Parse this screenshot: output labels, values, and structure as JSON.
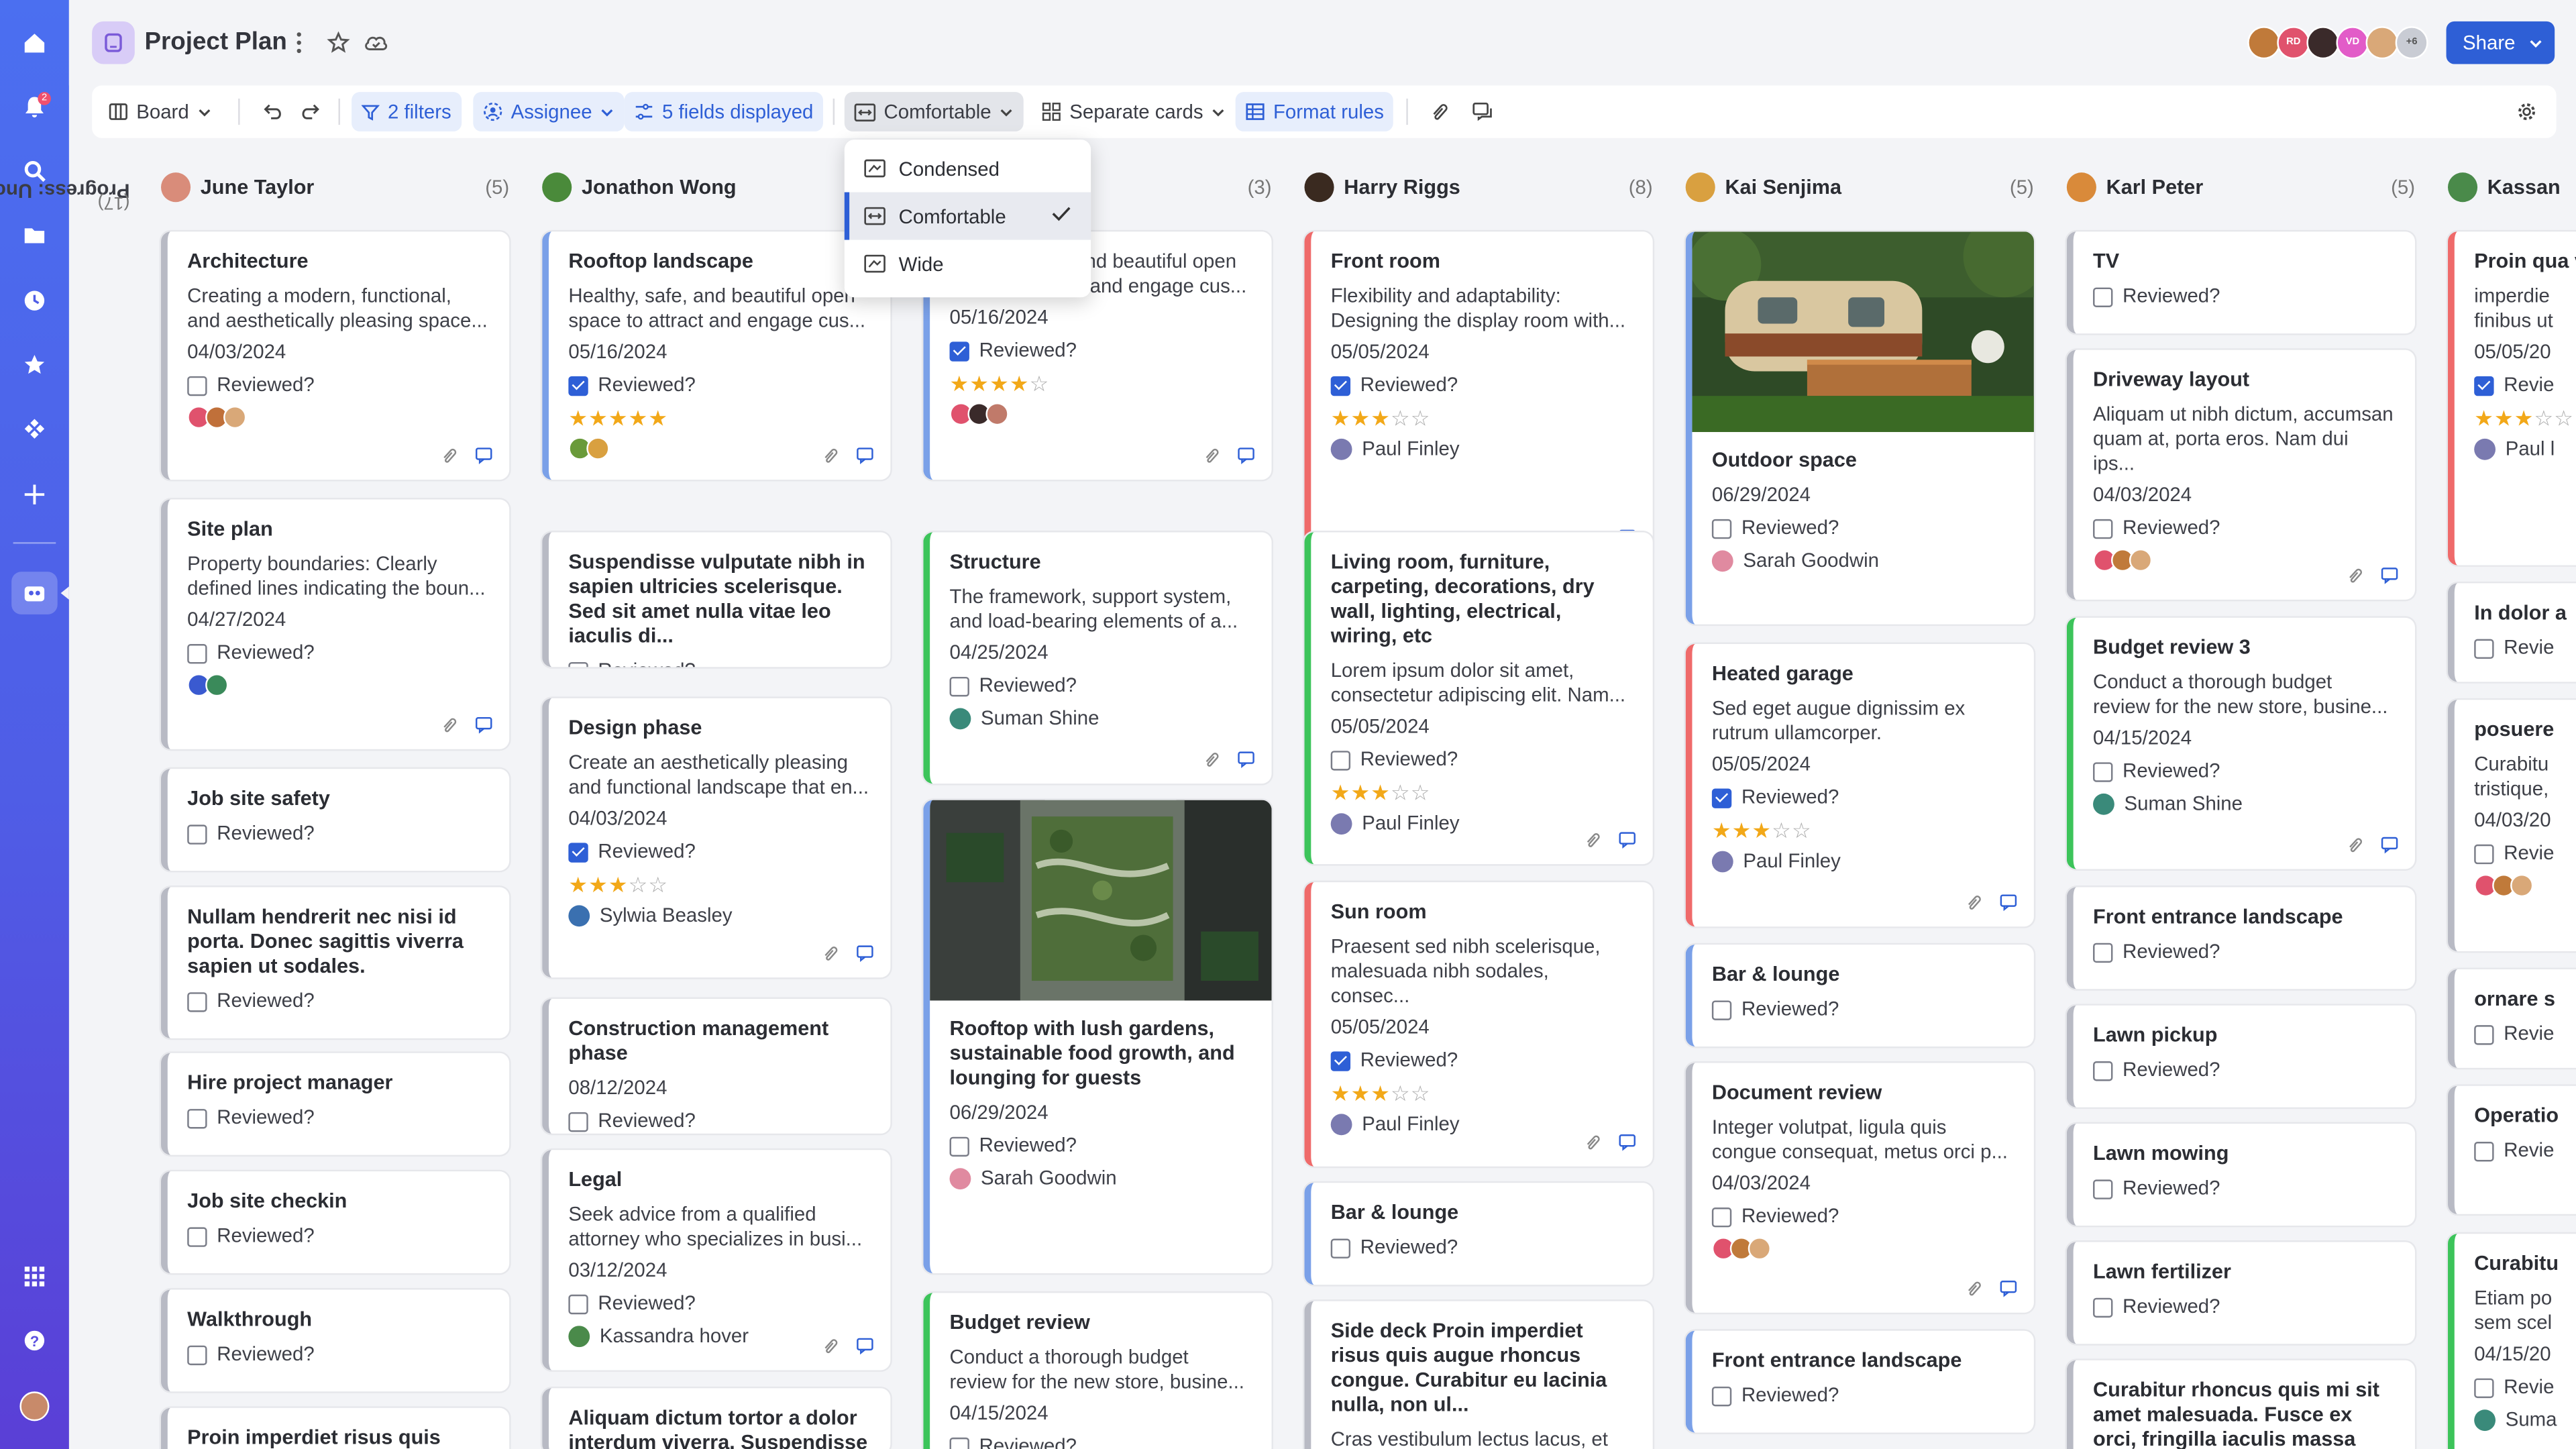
{
  "app": {
    "title": "Project Plan",
    "notification_count": "2",
    "share_label": "Share",
    "collaborators": [
      {
        "initials": "",
        "color": "#c07a3a"
      },
      {
        "initials": "RD",
        "color": "#e0526d"
      },
      {
        "initials": "",
        "color": "#3a2a2a"
      },
      {
        "initials": "VD",
        "color": "#e25cc8"
      },
      {
        "initials": "",
        "color": "#d9a878"
      },
      {
        "initials": "+6",
        "color": "#c9ccd4"
      }
    ]
  },
  "toolbar": {
    "view": "Board",
    "filters": "2 filters",
    "group_by": "Assignee",
    "fields": "5 fields displayed",
    "density": "Comfortable",
    "card_style": "Separate cards",
    "format_rules": "Format rules"
  },
  "density_menu": {
    "options": [
      "Condensed",
      "Comfortable",
      "Wide"
    ],
    "selected": "Comfortable"
  },
  "group": {
    "label": "Progress: Uncategorized",
    "count": "(17)"
  },
  "columns": [
    {
      "name": "June Taylor",
      "count": "(5)",
      "avatar": "#d98c7a",
      "cards": [
        {
          "title": "Architecture",
          "desc": "Creating a modern, functional,\nand aesthetically pleasing space...",
          "date": "04/03/2024",
          "reviewed_label": "Reviewed?",
          "reviewed": false,
          "avatars": [
            "#e0526d",
            "#c0703a",
            "#d9a878"
          ],
          "accent": "#b8bac4"
        },
        {
          "title": "Site plan",
          "desc": "Property boundaries: Clearly\ndefined lines indicating the boun...",
          "date": "04/27/2024",
          "reviewed_label": "Reviewed?",
          "reviewed": false,
          "avatars": [
            "#3a5ad0",
            "#3a8a5a"
          ],
          "accent": "#b8bac4"
        },
        {
          "title": "Job site safety",
          "reviewed_label": "Reviewed?",
          "reviewed": false,
          "accent": "#b8bac4"
        },
        {
          "title": "Nullam hendrerit nec nisi id porta. Donec sagittis viverra sapien ut sodales.",
          "reviewed_label": "Reviewed?",
          "reviewed": false,
          "accent": "#b8bac4"
        },
        {
          "title": "Hire project manager",
          "reviewed_label": "Reviewed?",
          "reviewed": false,
          "accent": "#b8bac4"
        },
        {
          "title": "Job site checkin",
          "reviewed_label": "Reviewed?",
          "reviewed": false,
          "accent": "#b8bac4"
        },
        {
          "title": "Walkthrough",
          "reviewed_label": "Reviewed?",
          "reviewed": false,
          "accent": "#b8bac4"
        },
        {
          "title": "Proin imperdiet risus quis augue",
          "accent": "#b8bac4"
        }
      ]
    },
    {
      "name": "Jonathon Wong",
      "count": "",
      "avatar": "#4a8a3a",
      "cards": [
        {
          "title": "Rooftop landscape",
          "desc": "Healthy, safe, and beautiful open\nspace to attract and engage cus...",
          "date": "05/16/2024",
          "reviewed_label": "Reviewed?",
          "reviewed": true,
          "stars": 5,
          "avatars": [
            "#6a9a3a",
            "#d9a040"
          ],
          "accent": "#7aa0e8"
        },
        {
          "title": "Suspendisse vulputate nibh in sapien ultricies scelerisque. Sed sit amet nulla vitae leo iaculis di...",
          "reviewed_label": "Reviewed?",
          "reviewed": false,
          "accent": "#b8bac4"
        },
        {
          "title": "Design phase",
          "desc": "Create an aesthetically pleasing\nand functional landscape that en...",
          "date": "04/03/2024",
          "reviewed_label": "Reviewed?",
          "reviewed": true,
          "stars": 3,
          "person": "Sylwia Beasley",
          "person_color": "#3a70b0",
          "accent": "#b8bac4"
        },
        {
          "title": "Construction management phase",
          "date": "08/12/2024",
          "reviewed_label": "Reviewed?",
          "reviewed": false,
          "accent": "#b8bac4"
        },
        {
          "title": "Legal",
          "desc": "Seek advice from a qualified\nattorney who specializes in busi...",
          "date": "03/12/2024",
          "reviewed_label": "Reviewed?",
          "reviewed": false,
          "person": "Kassandra hover",
          "person_color": "#4a8a4a",
          "accent": "#b8bac4"
        },
        {
          "title": "Aliquam dictum tortor a dolor interdum viverra. Suspendisse et",
          "accent": "#b8bac4"
        }
      ]
    },
    {
      "name": "",
      "count": "(3)",
      "avatar": "",
      "cards": [
        {
          "title": "",
          "desc": "Healthy, safe, and beautiful open\nspace to attract and engage cus...",
          "date": "05/16/2024",
          "reviewed_label": "Reviewed?",
          "reviewed": true,
          "stars": 4,
          "avatars": [
            "#e0526d",
            "#3a2a2a",
            "#c07a6a"
          ],
          "accent": "#7aa0e8"
        },
        {
          "title": "Structure",
          "desc": "The framework, support system,\nand load-bearing elements of a...",
          "date": "04/25/2024",
          "reviewed_label": "Reviewed?",
          "reviewed": false,
          "person": "Suman Shine",
          "person_color": "#3a8a7a",
          "accent": "#3cc45a"
        },
        {
          "title": "Rooftop with lush gardens, sustainable food growth, and lounging for guests",
          "date": "06/29/2024",
          "reviewed_label": "Reviewed?",
          "reviewed": false,
          "person": "Sarah Goodwin",
          "person_color": "#e08aa0",
          "photo": "rooftop",
          "accent": "#7aa0e8"
        },
        {
          "title": "Budget review",
          "desc": "Conduct a thorough budget\nreview for the new store, busine...",
          "date": "04/15/2024",
          "reviewed_label": "Reviewed?",
          "accent": "#3cc45a"
        }
      ]
    },
    {
      "name": "Harry Riggs",
      "count": "(8)",
      "avatar": "#3a2a20",
      "cards": [
        {
          "title": "Front room",
          "desc": "Flexibility and adaptability:\nDesigning the display room with...",
          "date": "05/05/2024",
          "reviewed_label": "Reviewed?",
          "reviewed": true,
          "stars": 3,
          "person": "Paul Finley",
          "person_color": "#7a7ab0",
          "accent": "#ef6a6a"
        },
        {
          "title": "Living room, furniture, carpeting, decorations, dry wall, lighting, electrical, wiring, etc",
          "desc": "Lorem ipsum dolor sit amet,\nconsectetur adipiscing elit. Nam...",
          "date": "05/05/2024",
          "reviewed_label": "Reviewed?",
          "reviewed": false,
          "stars": 3,
          "person": "Paul Finley",
          "person_color": "#7a7ab0",
          "accent": "#3cc45a"
        },
        {
          "title": "Sun room",
          "desc": "Praesent sed nibh scelerisque,\nmalesuada nibh sodales, consec...",
          "date": "05/05/2024",
          "reviewed_label": "Reviewed?",
          "reviewed": true,
          "stars": 3,
          "person": "Paul Finley",
          "person_color": "#7a7ab0",
          "accent": "#ef6a6a"
        },
        {
          "title": "Bar & lounge",
          "reviewed_label": "Reviewed?",
          "reviewed": false,
          "accent": "#7aa0e8"
        },
        {
          "title": "Side deck Proin imperdiet risus quis augue rhoncus congue. Curabitur eu lacinia nulla, non ul...",
          "desc": "Cras vestibulum lectus lacus, et\ntincidunt lectus vestibulum at. In...",
          "accent": "#b8bac4"
        }
      ]
    },
    {
      "name": "Kai Senjima",
      "count": "(5)",
      "avatar": "#d9a040",
      "cards": [
        {
          "title": "Outdoor space",
          "date": "06/29/2024",
          "reviewed_label": "Reviewed?",
          "reviewed": false,
          "person": "Sarah Goodwin",
          "person_color": "#e08aa0",
          "photo": "camper",
          "accent": "#7aa0e8"
        },
        {
          "title": "Heated garage",
          "desc": "Sed eget augue dignissim ex\nrutrum ullamcorper.",
          "date": "05/05/2024",
          "reviewed_label": "Reviewed?",
          "reviewed": true,
          "stars": 3,
          "person": "Paul Finley",
          "person_color": "#7a7ab0",
          "accent": "#ef6a6a"
        },
        {
          "title": "Bar & lounge",
          "reviewed_label": "Reviewed?",
          "reviewed": false,
          "accent": "#7aa0e8"
        },
        {
          "title": "Document review",
          "desc": "Integer volutpat, ligula quis\ncongue consequat, metus orci p...",
          "date": "04/03/2024",
          "reviewed_label": "Reviewed?",
          "reviewed": false,
          "avatars": [
            "#e0526d",
            "#c07a3a",
            "#d9a878"
          ],
          "accent": "#b8bac4"
        },
        {
          "title": "Front entrance landscape",
          "reviewed_label": "Reviewed?",
          "reviewed": false,
          "accent": "#7aa0e8"
        }
      ]
    },
    {
      "name": "Karl Peter",
      "count": "(5)",
      "avatar": "#d98a3a",
      "cards": [
        {
          "title": "TV",
          "reviewed_label": "Reviewed?",
          "reviewed": false,
          "accent": "#b8bac4"
        },
        {
          "title": "Driveway layout",
          "desc": "Aliquam ut nibh dictum, accumsan\nquam at, porta eros. Nam dui ips...",
          "date": "04/03/2024",
          "reviewed_label": "Reviewed?",
          "reviewed": false,
          "avatars": [
            "#e0526d",
            "#c07a3a",
            "#d9a878"
          ],
          "accent": "#b8bac4"
        },
        {
          "title": "Budget review 3",
          "desc": "Conduct a thorough budget\nreview for the new store, busine...",
          "date": "04/15/2024",
          "reviewed_label": "Reviewed?",
          "reviewed": false,
          "person": "Suman Shine",
          "person_color": "#3a8a7a",
          "accent": "#3cc45a"
        },
        {
          "title": "Front entrance landscape",
          "reviewed_label": "Reviewed?",
          "reviewed": false,
          "accent": "#b8bac4"
        },
        {
          "title": "Lawn pickup",
          "reviewed_label": "Reviewed?",
          "reviewed": false,
          "accent": "#b8bac4"
        },
        {
          "title": "Lawn mowing",
          "reviewed_label": "Reviewed?",
          "reviewed": false,
          "accent": "#b8bac4"
        },
        {
          "title": "Lawn fertilizer",
          "reviewed_label": "Reviewed?",
          "reviewed": false,
          "accent": "#b8bac4"
        },
        {
          "title": "Curabitur rhoncus quis mi sit amet malesuada. Fusce ex orci, fringilla iaculis massa non, ornar...",
          "accent": "#b8bac4"
        }
      ]
    },
    {
      "name": "Kassan",
      "count": "",
      "avatar": "#4a8a4a",
      "cards": [
        {
          "title": "Proin qua\nvehicula\nSed orna",
          "desc": "imperdie\nfinibus ut",
          "date": "05/05/20",
          "reviewed_label": "Revie",
          "reviewed": true,
          "stars": 3,
          "person": "Paul l",
          "person_color": "#7a7ab0",
          "accent": "#ef6a6a"
        },
        {
          "title": "In dolor a",
          "reviewed_label": "Revie",
          "reviewed": false,
          "accent": "#b8bac4"
        },
        {
          "title": "posuere",
          "desc": "Curabitu\ntristique,",
          "date": "04/03/20",
          "reviewed_label": "Revie",
          "reviewed": false,
          "avatars": [
            "#e0526d",
            "#c07a3a",
            "#d9a878"
          ],
          "accent": "#b8bac4"
        },
        {
          "title": "ornare s",
          "reviewed_label": "Revie",
          "reviewed": false,
          "accent": "#b8bac4"
        },
        {
          "title": "Operatio",
          "reviewed_label": "Revie",
          "reviewed": false,
          "accent": "#b8bac4"
        },
        {
          "title": "Curabitu",
          "desc": "Etiam po\nsem scel",
          "date": "04/15/20",
          "reviewed_label": "Revie",
          "reviewed": false,
          "person": "Suma",
          "person_color": "#3a8a7a",
          "accent": "#3cc45a"
        }
      ]
    }
  ]
}
